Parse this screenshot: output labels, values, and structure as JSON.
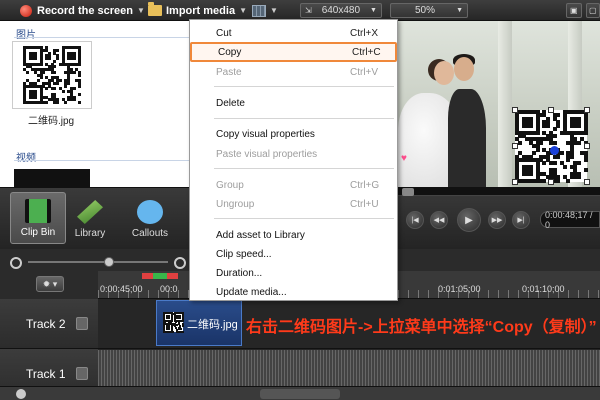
{
  "toolbar": {
    "record_label": "Record the screen",
    "import_label": "Import media",
    "resolution": "640x480",
    "zoom": "50%"
  },
  "clip_bin": {
    "images_section": "图片",
    "image_file": "二维码.jpg",
    "video_section": "视频"
  },
  "tabs": [
    {
      "label": "Clip Bin",
      "icon": "film-icon",
      "active": true
    },
    {
      "label": "Library",
      "icon": "library-icon"
    },
    {
      "label": "Callouts",
      "icon": "callout-icon"
    }
  ],
  "player": {
    "timecode": "0:00:48;17 / 0"
  },
  "timeline": {
    "ticks": [
      "0:00:45;00",
      "00:0",
      "0:01:05;00",
      "0:01:10;00"
    ],
    "tracks": [
      {
        "label": "Track 2",
        "clip": "二维码.jpg"
      },
      {
        "label": "Track 1"
      }
    ],
    "annotation": "右击二维码图片->上拉菜单中选择“Copy（复制）”"
  },
  "context_menu": {
    "items": [
      {
        "label": "Cut",
        "shortcut": "Ctrl+X",
        "enabled": true
      },
      {
        "label": "Copy",
        "shortcut": "Ctrl+C",
        "enabled": true,
        "highlighted": true
      },
      {
        "label": "Paste",
        "shortcut": "Ctrl+V",
        "enabled": false
      },
      {
        "label": "Delete",
        "shortcut": "",
        "enabled": true
      },
      {
        "label": "Copy visual properties",
        "shortcut": "",
        "enabled": true
      },
      {
        "label": "Paste visual properties",
        "shortcut": "",
        "enabled": false
      },
      {
        "label": "Group",
        "shortcut": "Ctrl+G",
        "enabled": false
      },
      {
        "label": "Ungroup",
        "shortcut": "Ctrl+U",
        "enabled": false
      },
      {
        "label": "Add asset to Library",
        "shortcut": "",
        "enabled": true
      },
      {
        "label": "Clip speed...",
        "shortcut": "",
        "enabled": true
      },
      {
        "label": "Duration...",
        "shortcut": "",
        "enabled": true
      },
      {
        "label": "Update media...",
        "shortcut": "",
        "enabled": true
      }
    ]
  },
  "colors": {
    "highlight_border": "#f0883a",
    "annotation": "#ff3a1a",
    "clip": "#2a4c8a"
  }
}
